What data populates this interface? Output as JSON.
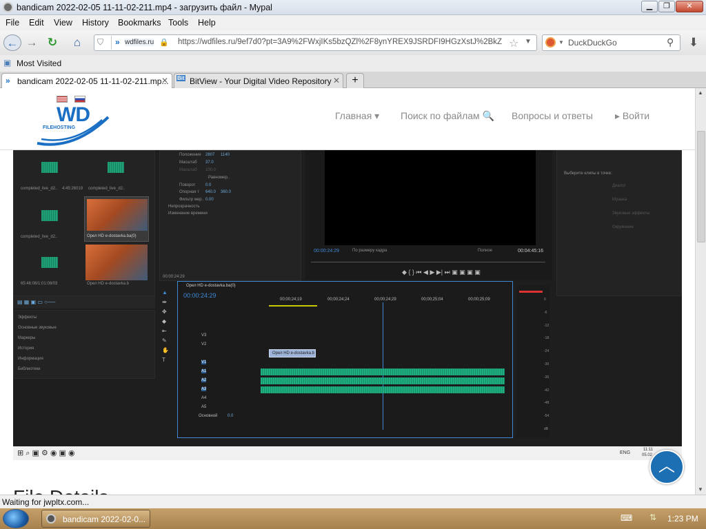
{
  "window": {
    "title": "bandicam 2022-02-05 11-11-02-211.mp4 - загрузить файл - Mypal"
  },
  "menu": [
    "File",
    "Edit",
    "View",
    "History",
    "Bookmarks",
    "Tools",
    "Help"
  ],
  "nav": {
    "site_badge": "wdfiles.ru",
    "url": "https://wdfiles.ru/9ef7d0?pt=3A9%2FWxjIKs5bzQZl%2F8ynYREX9JSRDFI9HGzXstJ%2BkZc%3D",
    "search_engine": "DuckDuckGo"
  },
  "bookmarks": {
    "most_visited": "Most Visited"
  },
  "tabs": [
    {
      "label": "bandicam 2022-02-05 11-11-02-211.mp..."
    },
    {
      "label": "BitView - Your Digital Video Repository"
    }
  ],
  "site": {
    "logo_text": "WD",
    "logo_sub": "FILEHOSTING",
    "nav": [
      "Главная ▾",
      "Поиск по файлам 🔍",
      "Вопросы и ответы",
      "▸ Войти"
    ],
    "section_heading": "File Details"
  },
  "editor": {
    "project_items": [
      {
        "label": "completed_live_d2..",
        "meta": "4:45:26019"
      },
      {
        "label": "completed_live_d2..",
        "meta": "4:45:26019"
      },
      {
        "label": "completed_live_d2..",
        "meta": "4:45:26019"
      },
      {
        "label": "Орел HD  e-dostavka.ba(0)",
        "meta": "6:27"
      },
      {
        "label": "65:46:08/1:01:08/03",
        "meta": "4:47:18018"
      },
      {
        "label": "Орел HD  e-dostavka.b",
        "meta": "4:45:16"
      }
    ],
    "effect_rows": [
      "Положение",
      "Масштаб",
      "Масштаб",
      "Равномер..",
      "Поворот",
      "Опорная т",
      "Фильтр мер.."
    ],
    "effect_values": [
      "2807",
      "1140",
      "37.0",
      "100.0",
      "0.0",
      "640.0",
      "360.0",
      "0.00"
    ],
    "effect_labels": [
      "Непрозрачность",
      "Изменение времени"
    ],
    "effect_timecode": "00:00:24:29",
    "effects_panel": [
      "Эффекты",
      "Основные звуковые",
      "Маркеры",
      "История",
      "Информация",
      "Библиотеки"
    ],
    "program": {
      "timecode": "00:00:24:29",
      "fit": "По размеру кадра",
      "quality": "Полное",
      "duration": "00:04:45:16"
    },
    "essential": {
      "heading": "Выберите клипы в точке:",
      "items": [
        "Диалог",
        "Музыка",
        "Звуковые эффекты",
        "Окружение"
      ]
    },
    "sequence": {
      "name": "Орел HD  e-dostavka.ba(0)",
      "timecode": "00:00:24:29",
      "ruler": [
        "00;00;24;19",
        "00;00;24;24",
        "00;00;24;29",
        "00;00;25;04",
        "00;00;25;09"
      ],
      "clip": "Орел HD  e-dostavka.b",
      "tracks": [
        "V3",
        "V2",
        "V1",
        "A1",
        "A2",
        "A3",
        "A4",
        "A5"
      ],
      "master": "Основной",
      "master_value": "0.0"
    },
    "meter_labels": [
      "0",
      "-6",
      "-12",
      "-18",
      "-24",
      "-30",
      "-36",
      "-42",
      "-48",
      "-54",
      "dB"
    ],
    "taskbar_inner": {
      "lang": "ENG",
      "time": "11:11",
      "date": "05.02"
    }
  },
  "status": "Waiting for jwpltx.com...",
  "taskbar": {
    "task": "bandicam 2022-02-0...",
    "time": "1:23 PM"
  },
  "colors": {
    "accent": "#1a6fc4",
    "scrolltop": "#1d6fb3"
  }
}
